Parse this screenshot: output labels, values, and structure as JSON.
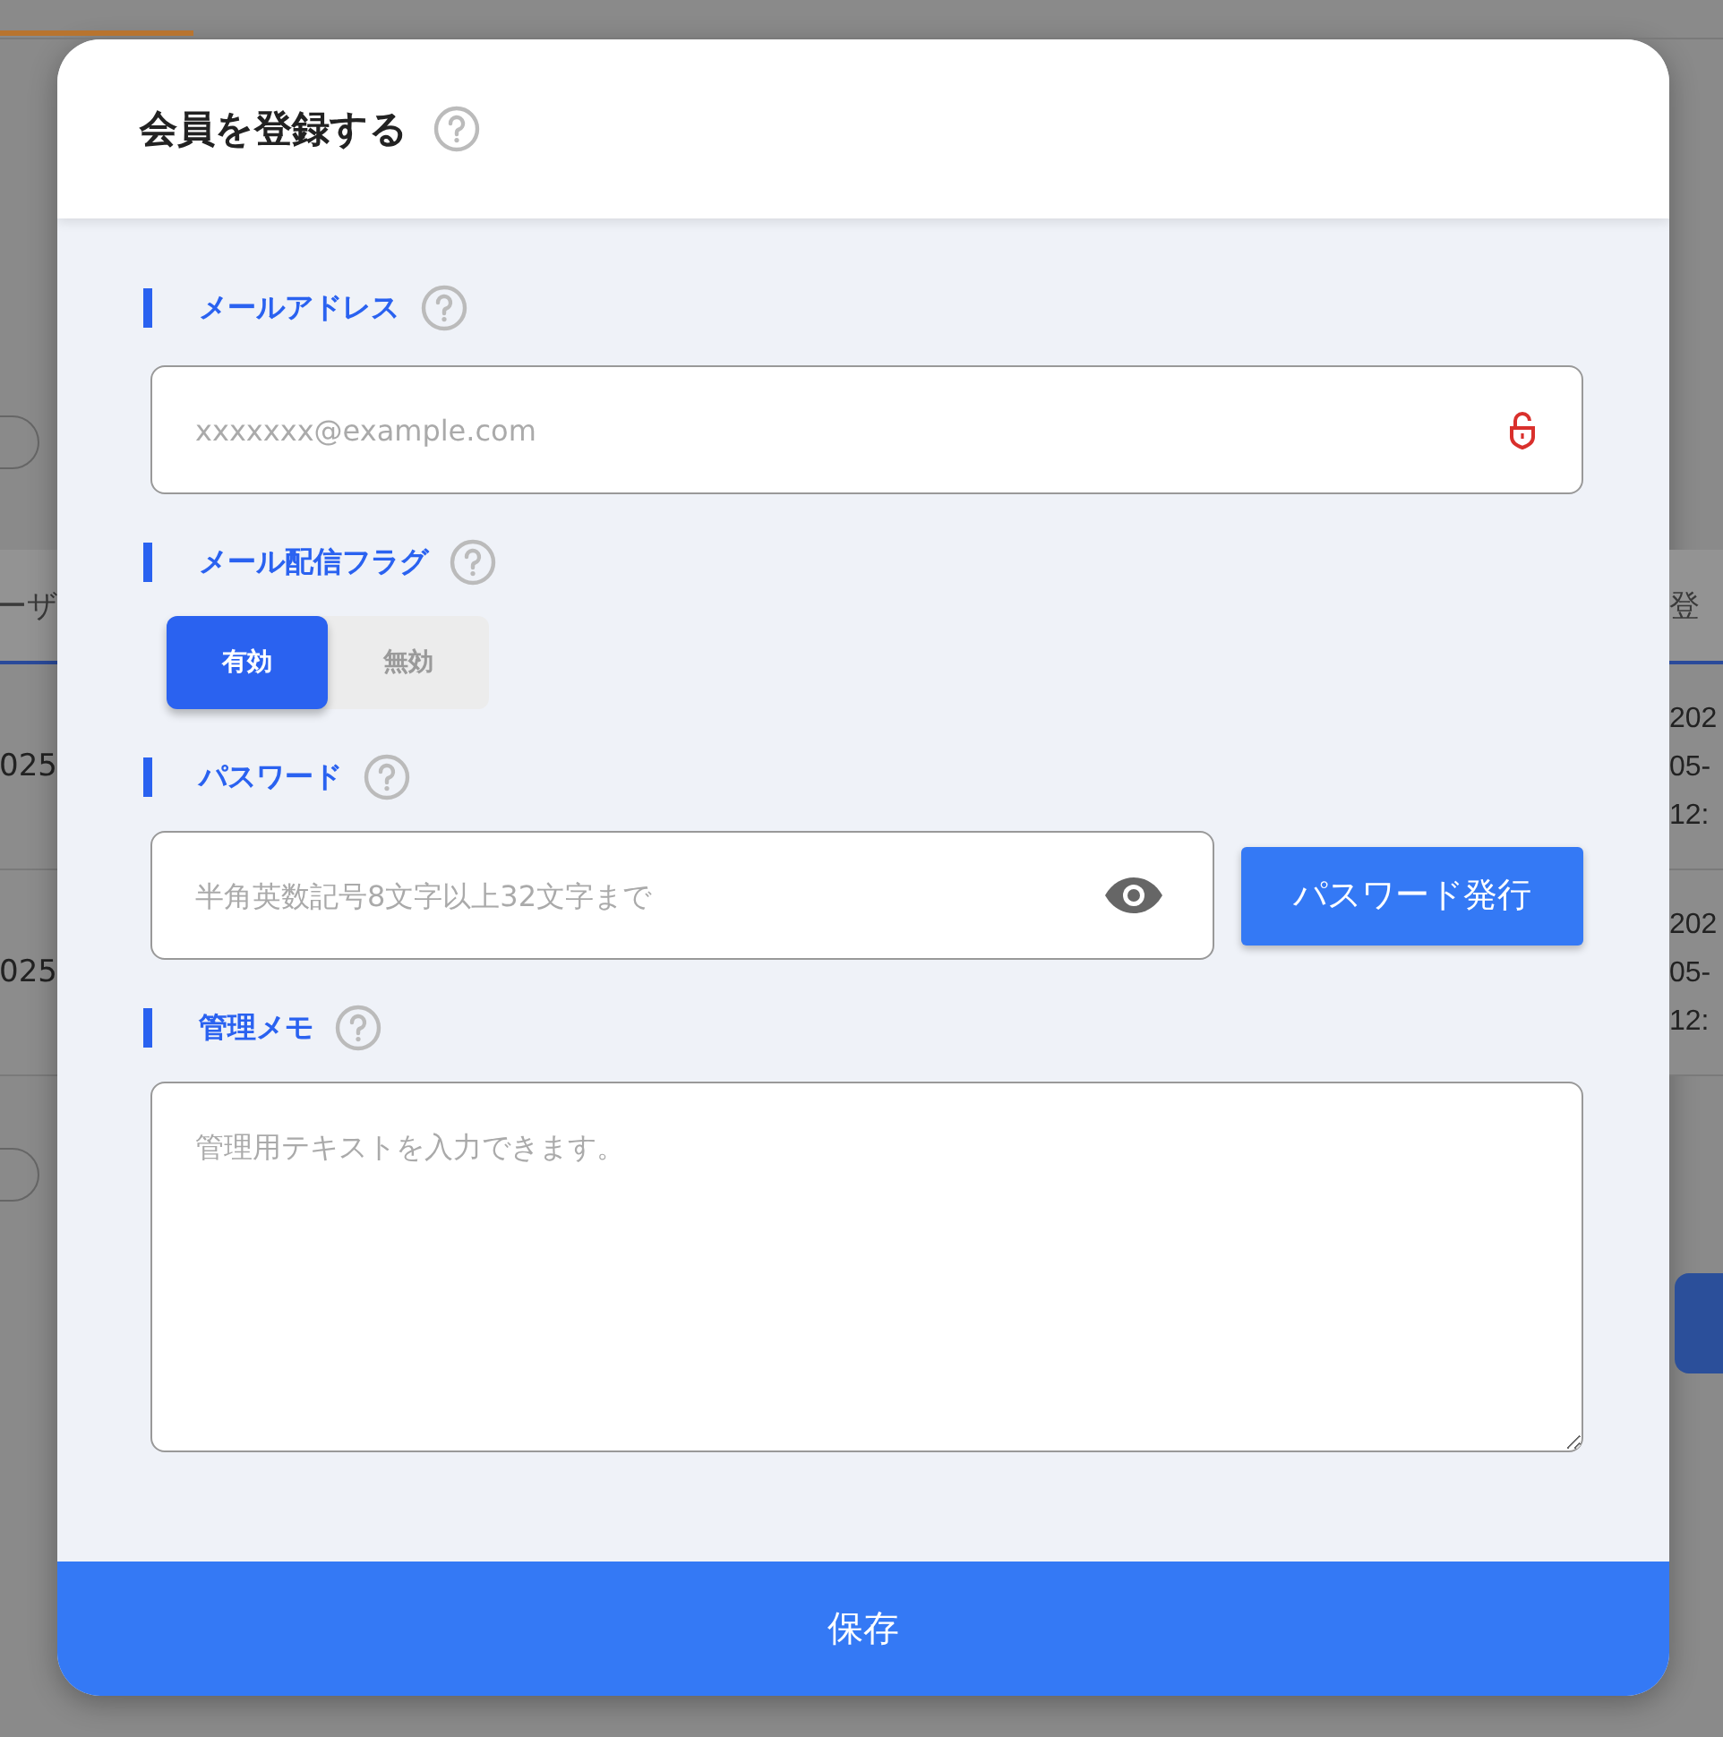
{
  "background": {
    "left_header": "ーザ",
    "left_rows": [
      "025",
      "025"
    ],
    "right_header": "登",
    "right_rows": [
      [
        "202",
        "05-",
        "12:"
      ],
      [
        "202",
        "05-",
        "12:"
      ]
    ]
  },
  "dialog": {
    "title": "会員を登録する",
    "fields": [
      {
        "kind": "text",
        "label": "メールアドレス",
        "placeholder": "xxxxxxx@example.com"
      },
      {
        "kind": "toggle",
        "label": "メール配信フラグ",
        "options": [
          {
            "label": "有効",
            "selected": true
          },
          {
            "label": "無効",
            "selected": false
          }
        ]
      },
      {
        "kind": "password",
        "label": "パスワード",
        "placeholder": "半角英数記号8文字以上32文字まで",
        "button": "パスワード発行"
      },
      {
        "kind": "textarea",
        "label": "管理メモ",
        "placeholder": "管理用テキストを入力できます。"
      }
    ],
    "save_button": "保存"
  }
}
